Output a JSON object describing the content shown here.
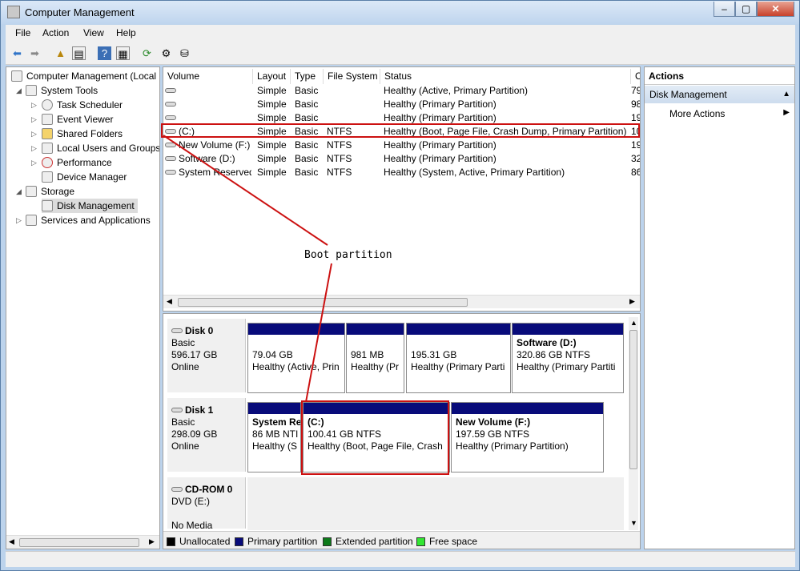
{
  "window": {
    "title": "Computer Management",
    "min": "–",
    "max": "▢",
    "close": "✕"
  },
  "menu": [
    "File",
    "Action",
    "View",
    "Help"
  ],
  "toolbar": [
    "back-icon",
    "forward-icon",
    "up-icon",
    "show-hide-tree-icon",
    "help-icon",
    "properties-icon",
    "refresh-icon",
    "settings-icon",
    "export-icon"
  ],
  "tree": [
    {
      "label": "Computer Management (Local",
      "indent": 0,
      "expander": ""
    },
    {
      "label": "System Tools",
      "indent": 1,
      "expander": "◢"
    },
    {
      "label": "Task Scheduler",
      "indent": 2,
      "expander": "▷"
    },
    {
      "label": "Event Viewer",
      "indent": 2,
      "expander": "▷"
    },
    {
      "label": "Shared Folders",
      "indent": 2,
      "expander": "▷"
    },
    {
      "label": "Local Users and Groups",
      "indent": 2,
      "expander": "▷"
    },
    {
      "label": "Performance",
      "indent": 2,
      "expander": "▷"
    },
    {
      "label": "Device Manager",
      "indent": 2,
      "expander": ""
    },
    {
      "label": "Storage",
      "indent": 1,
      "expander": "◢"
    },
    {
      "label": "Disk Management",
      "indent": 2,
      "expander": ""
    },
    {
      "label": "Services and Applications",
      "indent": 1,
      "expander": "▷"
    }
  ],
  "columns": [
    "Volume",
    "Layout",
    "Type",
    "File System",
    "Status",
    "C"
  ],
  "volumes": [
    {
      "volume": "",
      "layout": "Simple",
      "type": "Basic",
      "fs": "",
      "status": "Healthy (Active, Primary Partition)",
      "cap": "79"
    },
    {
      "volume": "",
      "layout": "Simple",
      "type": "Basic",
      "fs": "",
      "status": "Healthy (Primary Partition)",
      "cap": "98"
    },
    {
      "volume": "",
      "layout": "Simple",
      "type": "Basic",
      "fs": "",
      "status": "Healthy (Primary Partition)",
      "cap": "19"
    },
    {
      "volume": "(C:)",
      "layout": "Simple",
      "type": "Basic",
      "fs": "NTFS",
      "status": "Healthy (Boot, Page File, Crash Dump, Primary Partition)",
      "cap": "10"
    },
    {
      "volume": "New Volume (F:)",
      "layout": "Simple",
      "type": "Basic",
      "fs": "NTFS",
      "status": "Healthy (Primary Partition)",
      "cap": "19"
    },
    {
      "volume": "Software (D:)",
      "layout": "Simple",
      "type": "Basic",
      "fs": "NTFS",
      "status": "Healthy (Primary Partition)",
      "cap": "32"
    },
    {
      "volume": "System Reserved",
      "layout": "Simple",
      "type": "Basic",
      "fs": "NTFS",
      "status": "Healthy (System, Active, Primary Partition)",
      "cap": "86"
    }
  ],
  "annotation": "Boot partition",
  "disks": [
    {
      "name": "Disk 0",
      "type": "Basic",
      "size": "596.17 GB",
      "state": "Online",
      "partitions": [
        {
          "title": "",
          "line1": "79.04 GB",
          "line2": "Healthy (Active, Prin"
        },
        {
          "title": "",
          "line1": "981 MB",
          "line2": "Healthy (Pr"
        },
        {
          "title": "",
          "line1": "195.31 GB",
          "line2": "Healthy (Primary Parti"
        },
        {
          "title": "Software  (D:)",
          "line1": "320.86 GB NTFS",
          "line2": "Healthy (Primary Partiti"
        }
      ]
    },
    {
      "name": "Disk 1",
      "type": "Basic",
      "size": "298.09 GB",
      "state": "Online",
      "partitions": [
        {
          "title": "System Re",
          "line1": "86 MB NTI",
          "line2": "Healthy (S"
        },
        {
          "title": "(C:)",
          "line1": "100.41 GB NTFS",
          "line2": "Healthy (Boot, Page File, Crash"
        },
        {
          "title": "New Volume  (F:)",
          "line1": "197.59 GB NTFS",
          "line2": "Healthy (Primary Partition)"
        }
      ]
    },
    {
      "name": "CD-ROM 0",
      "type": "DVD (E:)",
      "size": "",
      "state": "No Media",
      "partitions": []
    }
  ],
  "legend": [
    {
      "label": "Unallocated",
      "color": "#000000"
    },
    {
      "label": "Primary partition",
      "color": "#080b7a"
    },
    {
      "label": "Extended partition",
      "color": "#0d7a1a"
    },
    {
      "label": "Free space",
      "color": "#32e632"
    }
  ],
  "actions": {
    "header": "Actions",
    "section": "Disk Management",
    "items": [
      "More Actions"
    ]
  },
  "colors": {
    "highlight": "#cc1111",
    "partition_bar": "#080b7a"
  }
}
